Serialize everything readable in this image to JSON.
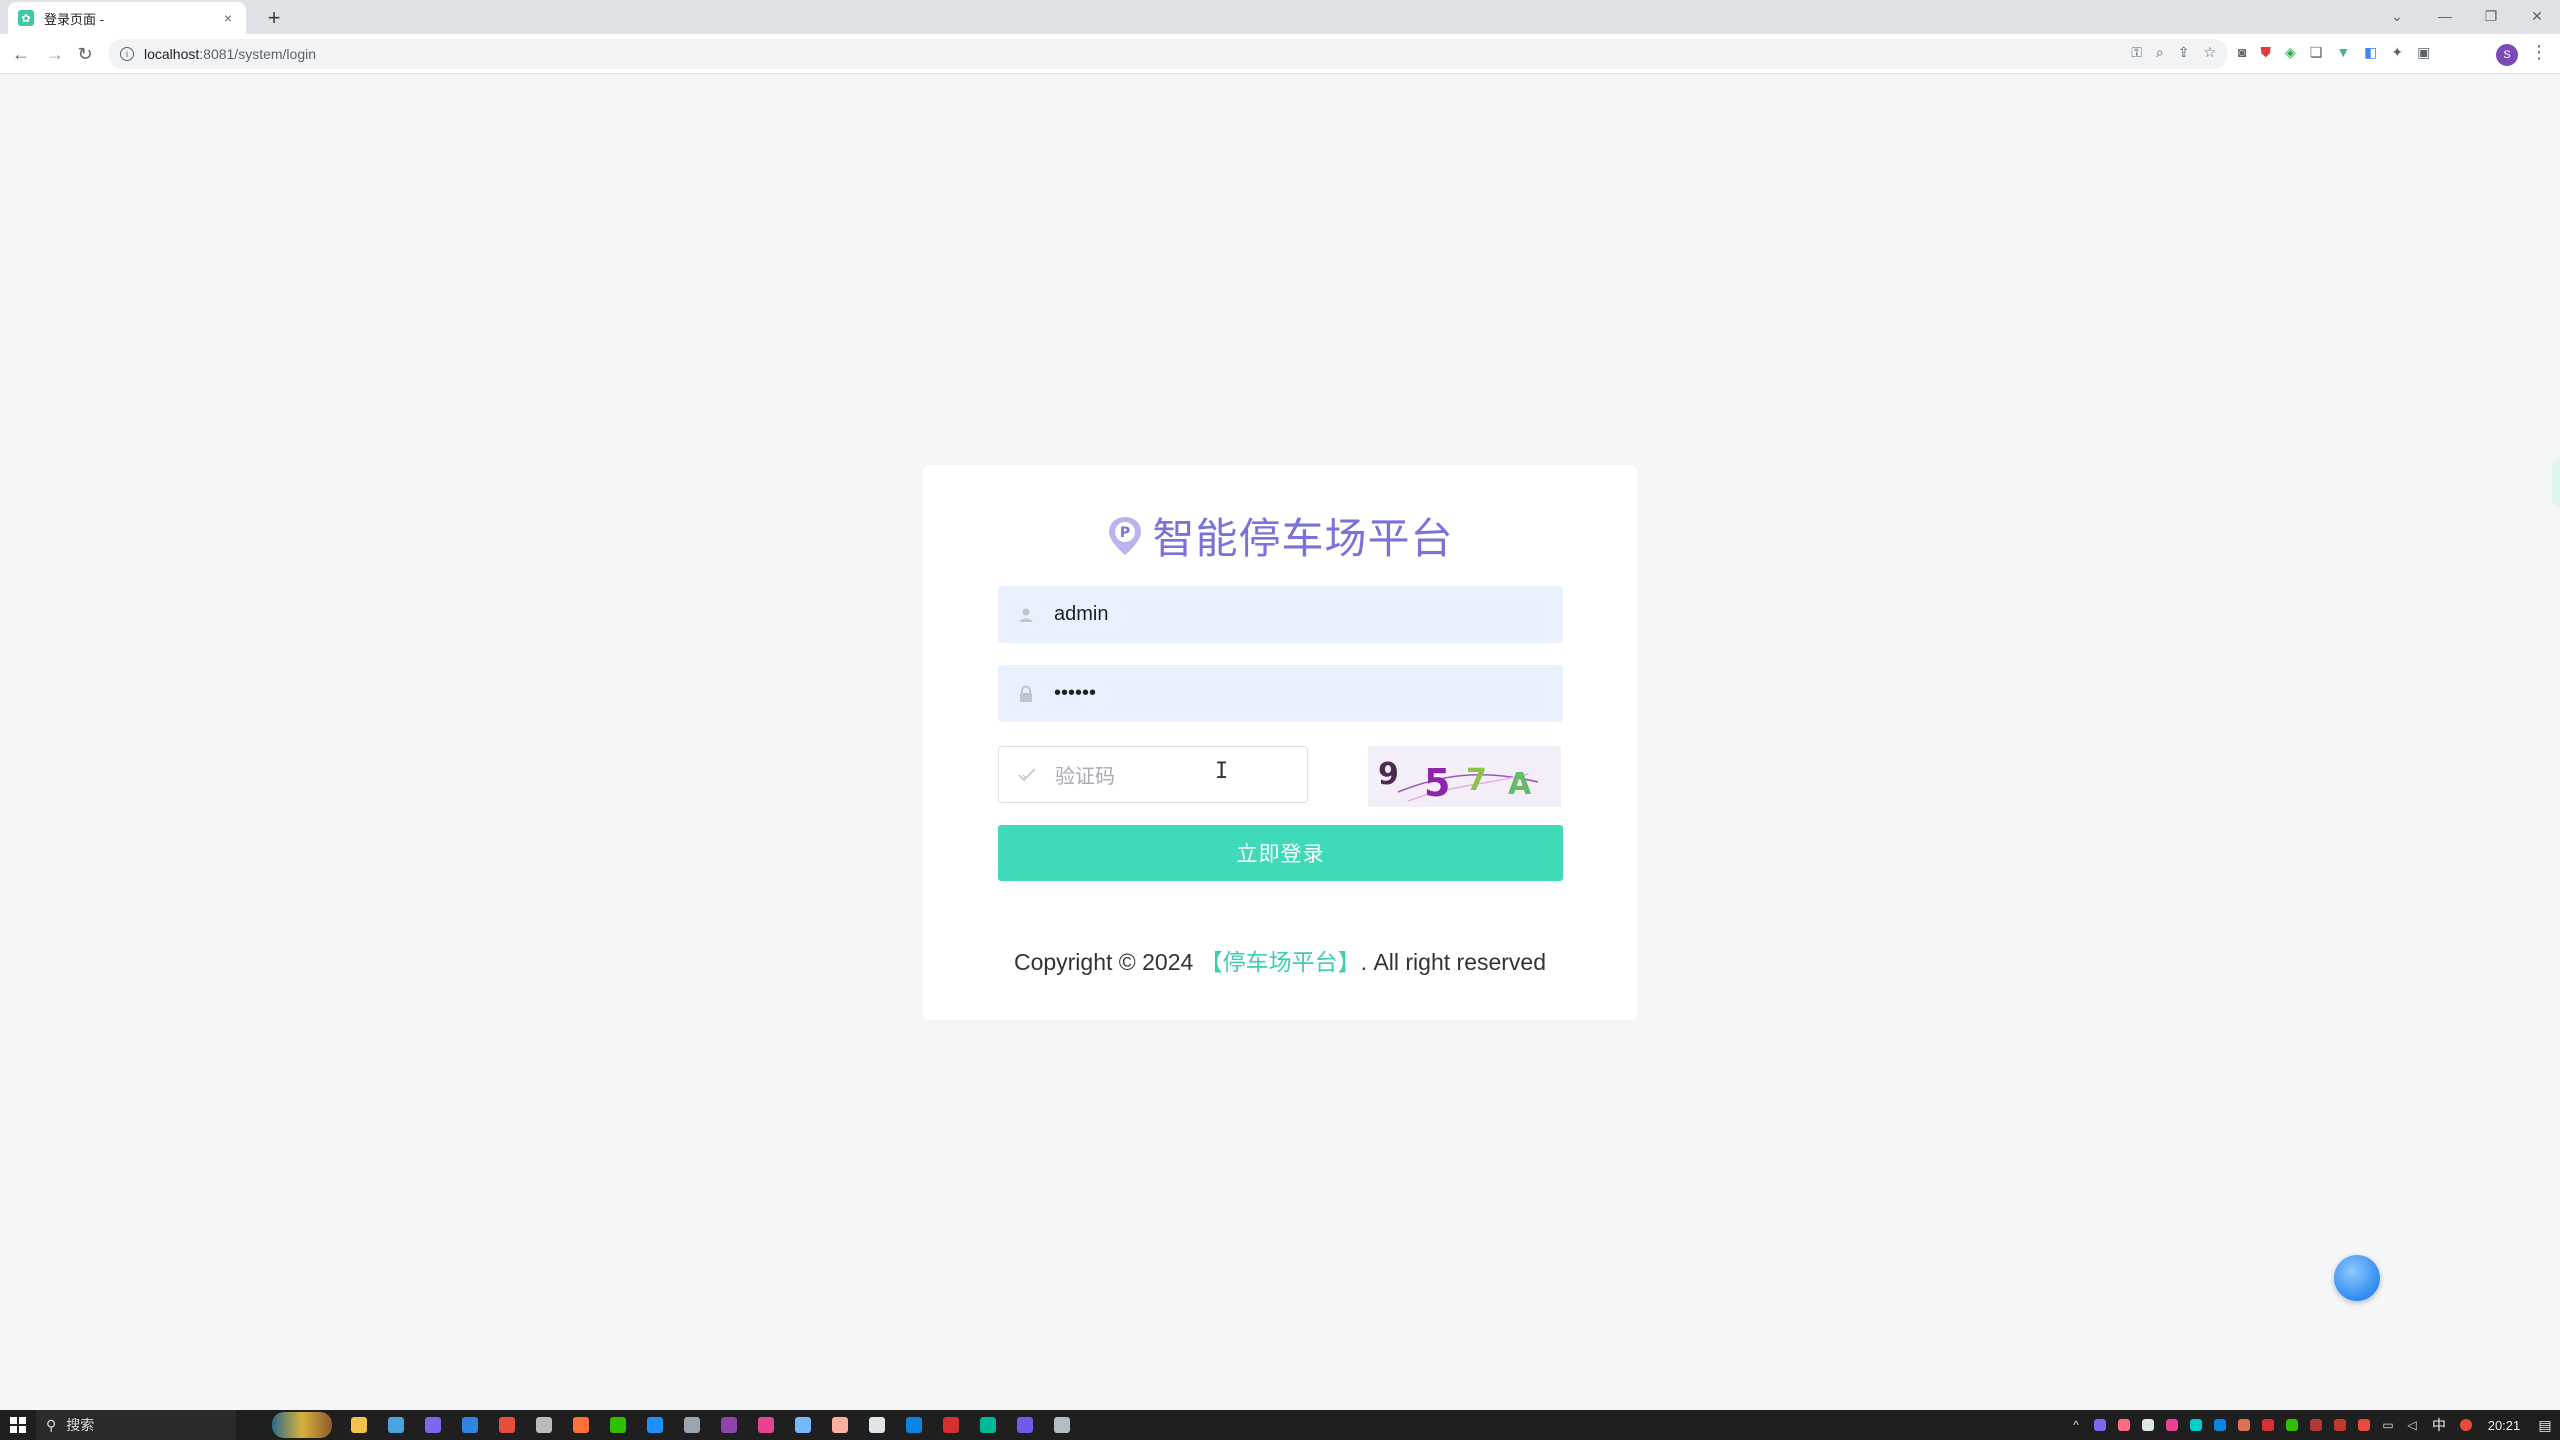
{
  "browser": {
    "tab_title": "登录页面 -",
    "tab_close": "×",
    "new_tab": "+",
    "url_host": "localhost",
    "url_path": ":8081/system/login",
    "back": "←",
    "forward": "→",
    "reload": "↻",
    "profile_initial": "S",
    "win_minimize": "—",
    "win_restore": "❐",
    "win_close": "✕",
    "tab_dropdown": "⌄"
  },
  "login": {
    "title": "智能停车场平台",
    "username_value": "admin",
    "password_value": "••••••",
    "captcha_placeholder": "验证码",
    "captcha_chars": [
      "9",
      "5",
      "7",
      "A"
    ],
    "submit_label": "立即登录",
    "copyright_prefix": "Copyright © 2024 ",
    "copyright_brand": "【停车场平台】",
    "copyright_suffix": ". All right reserved"
  },
  "colors": {
    "title": "#7a72d8",
    "button": "#3fdbb9",
    "brand_text": "#3fcdb0",
    "autofill_bg": "#e8f0fe"
  },
  "taskbar": {
    "search_label": "搜索",
    "ime": "中",
    "clock": "20:21",
    "apps": [
      {
        "name": "file-explorer",
        "color": "#f2c14e"
      },
      {
        "name": "store",
        "color": "#4aa3df"
      },
      {
        "name": "app-3",
        "color": "#7b68ee"
      },
      {
        "name": "app-4",
        "color": "#2e86de"
      },
      {
        "name": "chrome",
        "color": "#e74c3c"
      },
      {
        "name": "settings",
        "color": "#bbbbbb"
      },
      {
        "name": "firefox",
        "color": "#ff7139"
      },
      {
        "name": "wechat",
        "color": "#2dc100"
      },
      {
        "name": "vscode",
        "color": "#1e90ff"
      },
      {
        "name": "app-10",
        "color": "#9aa5b1"
      },
      {
        "name": "app-11",
        "color": "#8e44ad"
      },
      {
        "name": "app-12",
        "color": "#e84393"
      },
      {
        "name": "app-13",
        "color": "#74b9ff"
      },
      {
        "name": "app-14",
        "color": "#fab1a0"
      },
      {
        "name": "app-15",
        "color": "#dfe6e9"
      },
      {
        "name": "app-16",
        "color": "#0984e3"
      },
      {
        "name": "app-17",
        "color": "#d63031"
      },
      {
        "name": "app-18",
        "color": "#00b894"
      },
      {
        "name": "app-19",
        "color": "#6c5ce7"
      },
      {
        "name": "app-20",
        "color": "#b2bec3"
      }
    ]
  }
}
